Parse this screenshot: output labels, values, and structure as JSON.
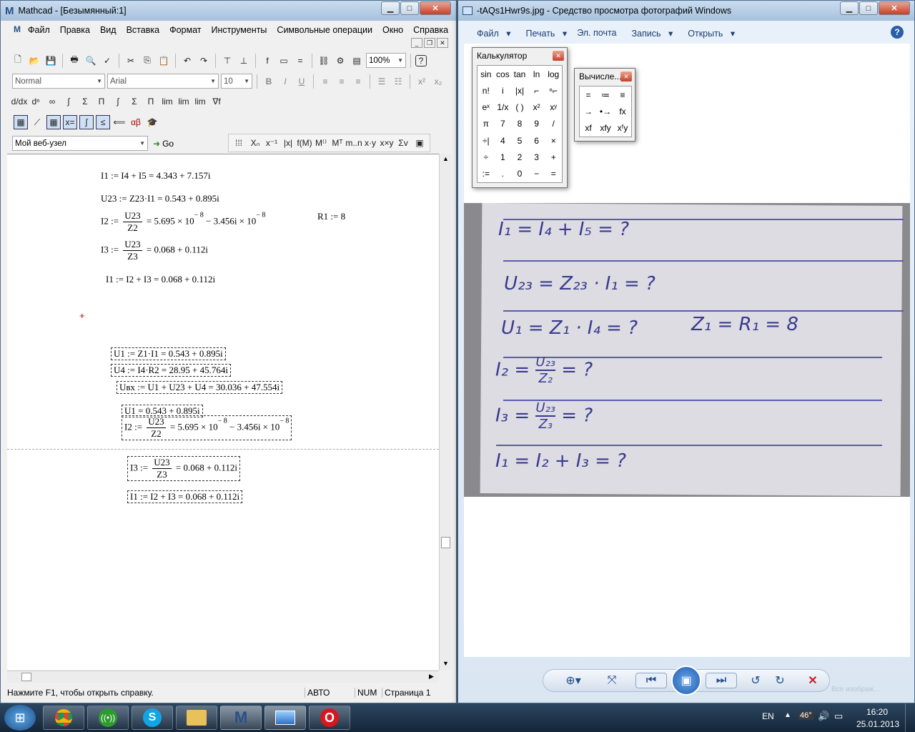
{
  "mathcad": {
    "title": "Mathcad - [Безымянный:1]",
    "menu": [
      "Файл",
      "Правка",
      "Вид",
      "Вставка",
      "Формат",
      "Инструменты",
      "Символьные операции",
      "Окно",
      "Справка"
    ],
    "style_combo": "Normal",
    "font_combo": "Arial",
    "size_combo": "10",
    "zoom_combo": "100%",
    "url_combo": "Мой веб-узел",
    "go_label": "Go",
    "math": {
      "l1": "I1 := I4 + I5 = 4.343 + 7.157i",
      "l2": "U23 := Z23·I1 = 0.543 + 0.895i",
      "i2_lhs": "I2 :=",
      "i2_num": "U23",
      "i2_den": "Z2",
      "i2_rhs": "= 5.695 × 10",
      "i2_exp1": "− 8",
      "i2_mid": " − 3.456i × 10",
      "i2_exp2": "− 8",
      "r1": "R1 := 8",
      "i3_lhs": "I3 :=",
      "i3_num": "U23",
      "i3_den": "Z3",
      "i3_rhs": "= 0.068 + 0.112i",
      "l5": "I1 := I2 + I3 = 0.068 + 0.112i",
      "b1": "U1 := Z1·I1 = 0.543 + 0.895i",
      "b2": "U4 := I4·R2 = 28.95 + 45.764i",
      "b3": "Uвх := U1 + U23 + U4 = 30.036 + 47.554i",
      "b4": "U1 = 0.543 + 0.895i",
      "b5_lhs": "I2 :=",
      "b5_num": "U23",
      "b5_den": "Z2",
      "b5_rhs": "= 5.695 × 10",
      "b5_exp1": "− 8",
      "b5_mid": " − 3.456i × 10",
      "b5_exp2": "− 8",
      "b6_lhs": "I3 :=",
      "b6_num": "U23",
      "b6_den": "Z3",
      "b6_rhs": "= 0.068 + 0.112i",
      "b7": "I1 := I2 + I3 = 0.068 + 0.112i"
    },
    "status": {
      "help": "Нажмите F1, чтобы открыть справку.",
      "auto": "АВТО",
      "num": "NUM",
      "page": "Страница 1"
    }
  },
  "viewer": {
    "title": "-tAQs1Hwr9s.jpg - Средство просмотра фотографий Windows",
    "menu": [
      "Файл",
      "Печать",
      "Эл. почта",
      "Запись",
      "Открыть"
    ],
    "faded": "Все изображ..."
  },
  "calculator": {
    "title": "Калькулятор",
    "keys": [
      "sin",
      "cos",
      "tan",
      "ln",
      "log",
      "n!",
      "i",
      "|x|",
      "⌐",
      "ⁿ⌐",
      "eˣ",
      "1/x",
      "( )",
      "x²",
      "xʸ",
      "π",
      "7",
      "8",
      "9",
      "/",
      "÷|",
      "4",
      "5",
      "6",
      "×",
      "÷",
      "1",
      "2",
      "3",
      "+",
      ":=",
      ".",
      "0",
      "−",
      "="
    ]
  },
  "evaluation": {
    "title": "Вычисле...",
    "keys": [
      "=",
      "≔",
      "≡",
      "→",
      "•→",
      "fx",
      "xf",
      "xfy",
      "xᶠy"
    ]
  },
  "photo_text": {
    "l1": "I₁ = I₄ + I₅ = ?",
    "l2": "U₂₃ = Z₂₃ · I₁ = ?",
    "l3": "U₁ = Z₁ · I₄ = ?",
    "l3b": "Z₁ = R₁ = 8",
    "l4a": "I₂ =",
    "l4n": "U₂₃",
    "l4d": "Z₂",
    "l4b": "= ?",
    "l5a": "I₃ =",
    "l5n": "U₂₃",
    "l5d": "Z₃",
    "l5b": "= ?",
    "l6": "I₁ = I₂ + I₃ = ?"
  },
  "tray": {
    "lang": "EN",
    "temp": "46°",
    "time": "16:20",
    "date": "25.01.2013"
  }
}
